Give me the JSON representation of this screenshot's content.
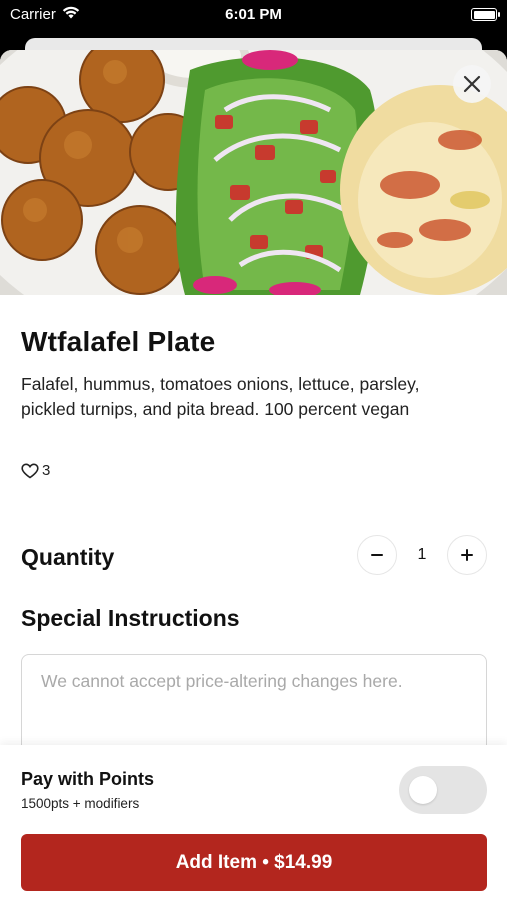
{
  "status_bar": {
    "carrier": "Carrier",
    "time": "6:01 PM",
    "battery_level": 1.0
  },
  "item": {
    "title": "Wtfalafel Plate",
    "description": "Falafel, hummus, tomatoes onions, lettuce, parsley, pickled turnips, and pita bread. 100 percent vegan",
    "likes": "3",
    "image_alt": "Falafel plate with salad and hummus"
  },
  "quantity": {
    "label": "Quantity",
    "value": "1",
    "decrement_icon": "minus-icon",
    "increment_icon": "plus-icon"
  },
  "instructions": {
    "label": "Special Instructions",
    "placeholder": "We cannot accept price-altering changes here.",
    "value": ""
  },
  "points": {
    "title": "Pay with Points",
    "subtitle": "1500pts + modifiers",
    "enabled": false
  },
  "add_button": {
    "label": "Add Item • $14.99"
  },
  "colors": {
    "accent": "#b3261e",
    "toggle_off": "#e4e4e4"
  }
}
